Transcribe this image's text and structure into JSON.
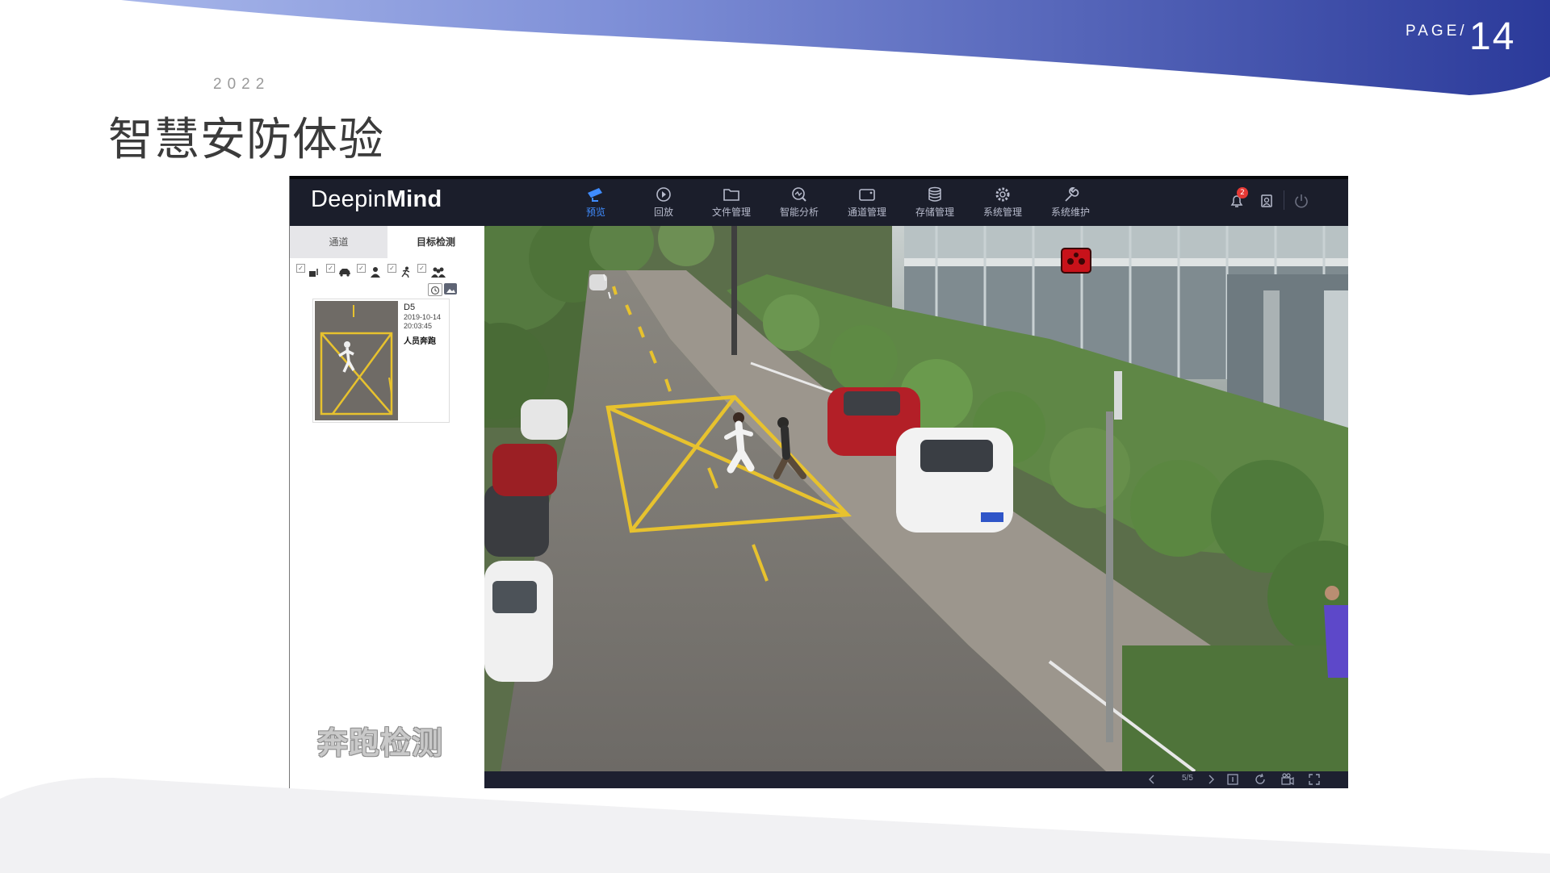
{
  "slide": {
    "page_label": "PAGE/",
    "page_number": "14",
    "year": "2022",
    "title": "智慧安防体验"
  },
  "app": {
    "brand_regular": "Deepin",
    "brand_bold": "Mind",
    "nav": [
      {
        "label": "预览",
        "icon": "camera-icon",
        "active": true
      },
      {
        "label": "回放",
        "icon": "playback-icon",
        "active": false
      },
      {
        "label": "文件管理",
        "icon": "folder-icon",
        "active": false
      },
      {
        "label": "智能分析",
        "icon": "analysis-icon",
        "active": false
      },
      {
        "label": "通道管理",
        "icon": "channel-icon",
        "active": false
      },
      {
        "label": "存储管理",
        "icon": "database-icon",
        "active": false
      },
      {
        "label": "系统管理",
        "icon": "gear-icon",
        "active": false
      },
      {
        "label": "系统维护",
        "icon": "wrench-icon",
        "active": false
      }
    ],
    "notification_count": "2",
    "colors": {
      "header_bg": "#1b1e2b",
      "active_nav": "#3f8cff",
      "badge": "#e53935",
      "road_marking": "#e7c22e"
    }
  },
  "left_panel": {
    "tabs": [
      "通道",
      "目标检测"
    ],
    "active_tab": "目标检测",
    "filter_icons": [
      "vehicle-icon",
      "car-icon",
      "person-icon",
      "running-person-icon",
      "crowd-icon"
    ],
    "event": {
      "channel": "D5",
      "date": "2019-10-14",
      "time": "20:03:45",
      "type": "人员奔跑"
    },
    "caption": "奔跑检测"
  },
  "video": {
    "pager": "5/5"
  }
}
